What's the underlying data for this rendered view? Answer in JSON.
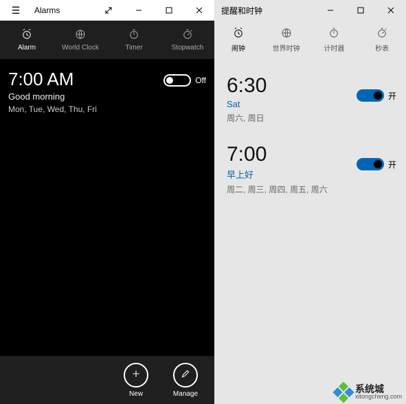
{
  "left": {
    "title": "Alarms",
    "tabs": [
      {
        "id": "alarm",
        "label": "Alarm",
        "active": true
      },
      {
        "id": "worldclock",
        "label": "World Clock",
        "active": false
      },
      {
        "id": "timer",
        "label": "Timer",
        "active": false
      },
      {
        "id": "stopwatch",
        "label": "Stopwatch",
        "active": false
      }
    ],
    "alarms": [
      {
        "time": "7:00 AM",
        "name": "Good morning",
        "days": "Mon, Tue, Wed, Thu, Fri",
        "state_label": "Off",
        "on": false
      }
    ],
    "commands": {
      "new": "New",
      "manage": "Manage"
    }
  },
  "right": {
    "title": "提醒和时钟",
    "tabs": [
      {
        "id": "alarm",
        "label": "闹钟",
        "active": true
      },
      {
        "id": "worldclock",
        "label": "世界时钟",
        "active": false
      },
      {
        "id": "timer",
        "label": "计时器",
        "active": false
      },
      {
        "id": "stopwatch",
        "label": "秒表",
        "active": false
      }
    ],
    "alarms": [
      {
        "time": "6:30",
        "name": "Sat",
        "days": "周六, 周日",
        "state_label": "开",
        "on": true
      },
      {
        "time": "7:00",
        "name": "早上好",
        "days": "周二, 周三, 周四, 周五, 周六",
        "state_label": "开",
        "on": true
      }
    ]
  },
  "watermark": {
    "cn": "系统城",
    "url": "xitongcheng.com"
  }
}
